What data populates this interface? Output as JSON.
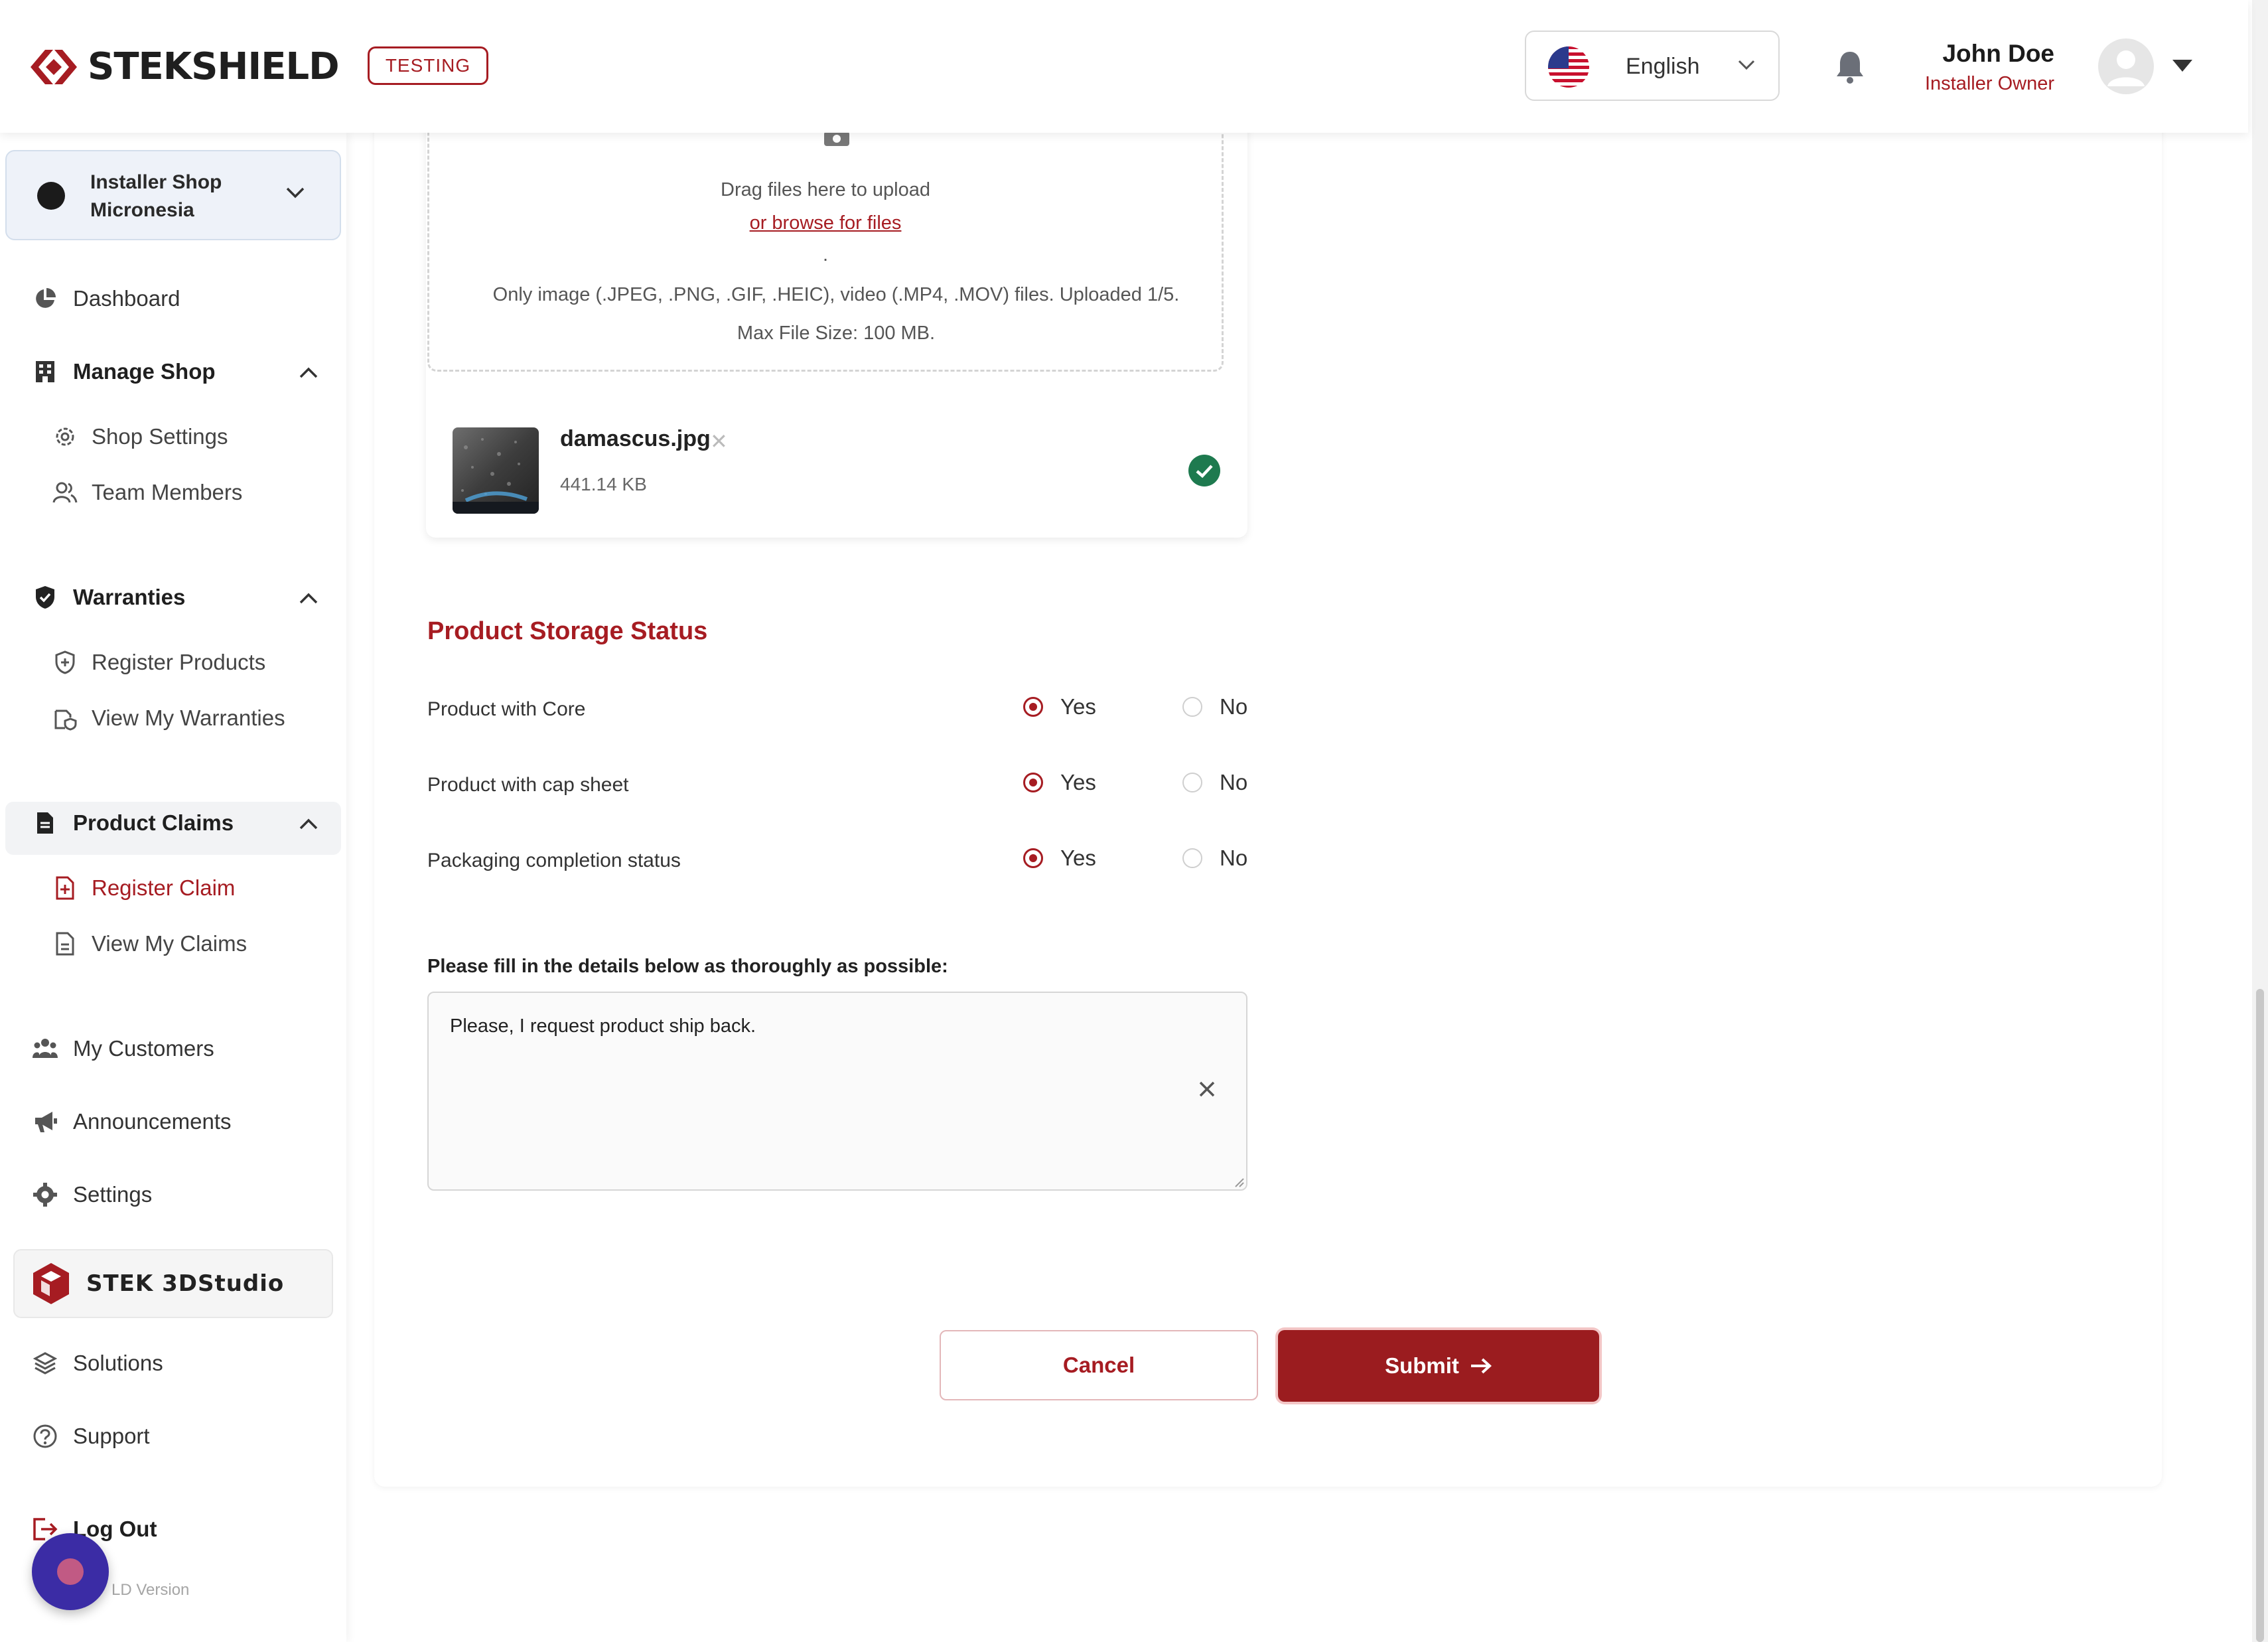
{
  "header": {
    "brand": "STEKSHIELD",
    "env_badge": "TESTING",
    "language": "English",
    "user_name": "John Doe",
    "user_role": "Installer Owner"
  },
  "sidebar": {
    "shop_name_line1": "Installer Shop",
    "shop_name_line2": "Micronesia",
    "dashboard": "Dashboard",
    "manage_shop": "Manage Shop",
    "shop_settings": "Shop Settings",
    "team_members": "Team Members",
    "warranties": "Warranties",
    "register_products": "Register Products",
    "view_my_warranties": "View My Warranties",
    "product_claims": "Product Claims",
    "register_claim": "Register Claim",
    "view_my_claims": "View My Claims",
    "my_customers": "My Customers",
    "announcements": "Announcements",
    "settings": "Settings",
    "studio": "STEK 3DStudio",
    "solutions": "Solutions",
    "support": "Support",
    "logout": "Log Out",
    "version": "LD Version"
  },
  "upload": {
    "drag_text": "Drag files here to upload",
    "browse_text": "or browse for files",
    "dot": ".",
    "types_text": "Only image (.JPEG, .PNG, .GIF, .HEIC), video (.MP4, .MOV) files. Uploaded 1/5.",
    "max_text": "Max File Size: 100 MB.",
    "file_name": "damascus.jpg",
    "file_size": "441.14 KB"
  },
  "storage": {
    "title": "Product Storage Status",
    "yes": "Yes",
    "no": "No",
    "questions": [
      {
        "label": "Product with Core",
        "selected": "Yes"
      },
      {
        "label": "Product with cap sheet",
        "selected": "Yes"
      },
      {
        "label": "Packaging completion status",
        "selected": "Yes"
      }
    ]
  },
  "details": {
    "label": "Please fill in the details below as thoroughly as possible:",
    "value": "Please, I request product ship back."
  },
  "actions": {
    "cancel": "Cancel",
    "submit": "Submit"
  },
  "colors": {
    "brand_red": "#a61c22",
    "submit_bg": "#9b1c1f",
    "success_green": "#1e7a4f"
  }
}
